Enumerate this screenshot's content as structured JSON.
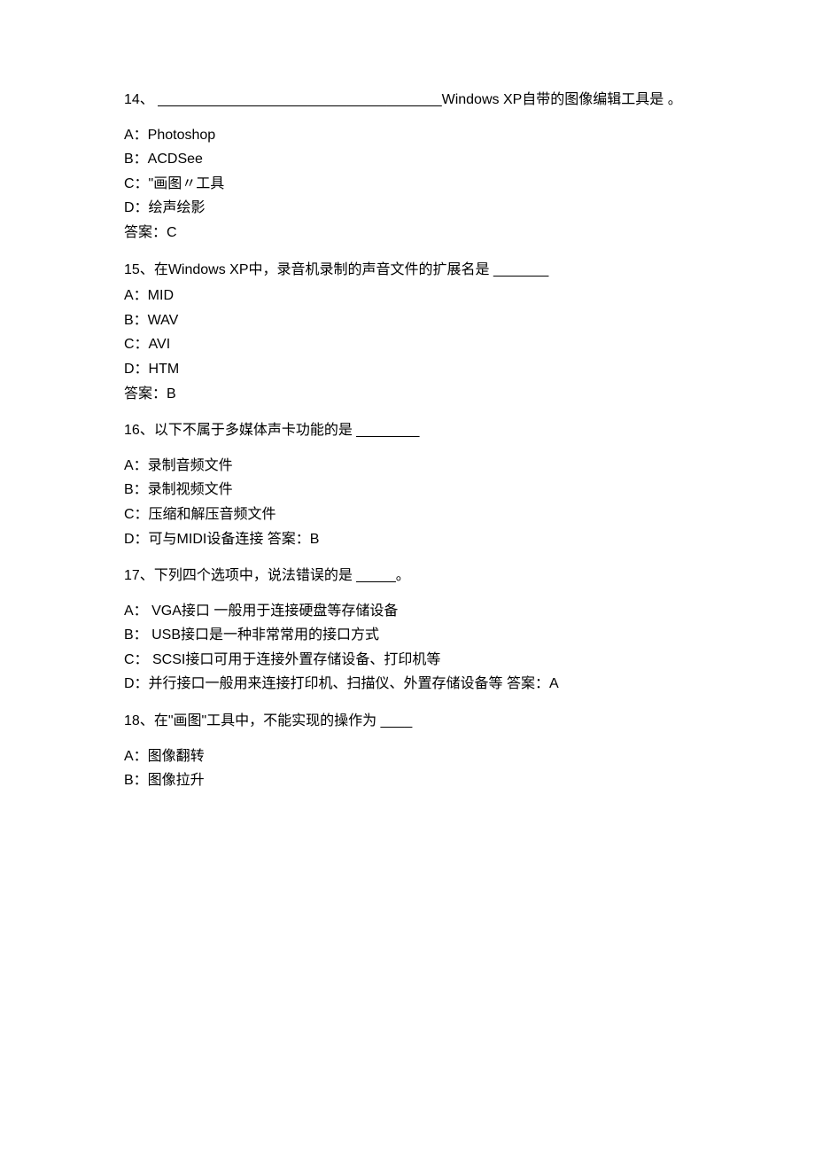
{
  "questions": [
    {
      "number": "14、",
      "text": " ____________________________________Windows XP自带的图像编辑工具是  。",
      "options": [
        "A：Photoshop",
        "B：ACDSee",
        "C：\"画图〃工具",
        "D：绘声绘影"
      ],
      "answer": "答案：C"
    },
    {
      "number": "15、",
      "text": "在Windows XP中，录音机录制的声音文件的扩展名是 _______",
      "options": [
        "A：MID",
        "B：WAV",
        "C：AVI",
        "D：HTM"
      ],
      "answer": "答案：B"
    },
    {
      "number": "16、",
      "text": "以下不属于多媒体声卡功能的是 ________",
      "options": [
        "A：录制音频文件",
        "B：录制视频文件",
        "C：压缩和解压音频文件",
        "D：可与MIDI设备连接  答案：B"
      ],
      "answer": ""
    },
    {
      "number": "17、",
      "text": "下列四个选项中，说法错误的是 _____。",
      "options": [
        "A：  VGA接口 一般用于连接硬盘等存储设备",
        "B：  USB接口是一种非常常用的接口方式",
        "C：  SCSI接口可用于连接外置存储设备、打印机等",
        "D：并行接口一般用来连接打印机、扫描仪、外置存储设备等  答案：A"
      ],
      "answer": ""
    },
    {
      "number": "18、",
      "text": "在\"画图\"工具中，不能实现的操作为 ____",
      "options": [
        "A：图像翻转",
        "B：图像拉升"
      ],
      "answer": ""
    }
  ]
}
